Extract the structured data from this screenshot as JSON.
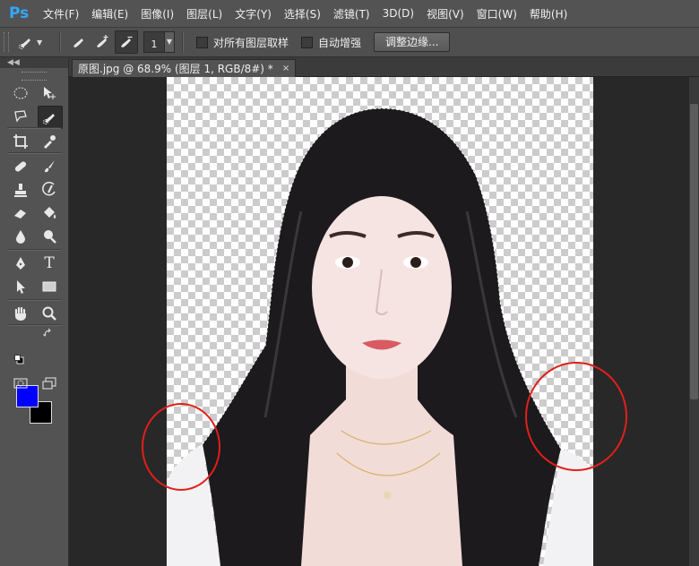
{
  "app": {
    "logo": "Ps"
  },
  "menu": [
    "文件(F)",
    "编辑(E)",
    "图像(I)",
    "图层(L)",
    "文字(Y)",
    "选择(S)",
    "滤镜(T)",
    "3D(D)",
    "视图(V)",
    "窗口(W)",
    "帮助(H)"
  ],
  "options": {
    "tool_preset_icon": "quick-selection-brush-icon",
    "modes": [
      "new-selection-icon",
      "add-to-selection-icon",
      "subtract-from-selection-icon"
    ],
    "brush_size": "1",
    "sample_all_layers": {
      "label": "对所有图层取样",
      "checked": false
    },
    "auto_enhance": {
      "label": "自动增强",
      "checked": false
    },
    "refine_edge_label": "调整边缘..."
  },
  "toolbox": {
    "tools": [
      "elliptical-marquee-icon",
      "move-icon",
      "lasso-icon",
      "quick-selection-icon",
      "crop-icon",
      "eyedropper-icon",
      "healing-brush-icon",
      "brush-icon",
      "clone-stamp-icon",
      "history-brush-icon",
      "eraser-icon",
      "paint-bucket-icon",
      "blur-icon",
      "dodge-icon",
      "pen-icon",
      "type-icon",
      "path-selection-icon",
      "rectangle-icon",
      "hand-icon",
      "zoom-icon"
    ],
    "type_tool_glyph": "T",
    "foreground_color": "#0000ff",
    "background_color": "#000000"
  },
  "document": {
    "tab_title": "原图.jpg @ 68.9% (图层 1, RGB/8#) *",
    "close_glyph": "×"
  },
  "colors": {
    "highlight_ring": "#e0201a",
    "panel": "#535353",
    "workspace": "#282828"
  }
}
